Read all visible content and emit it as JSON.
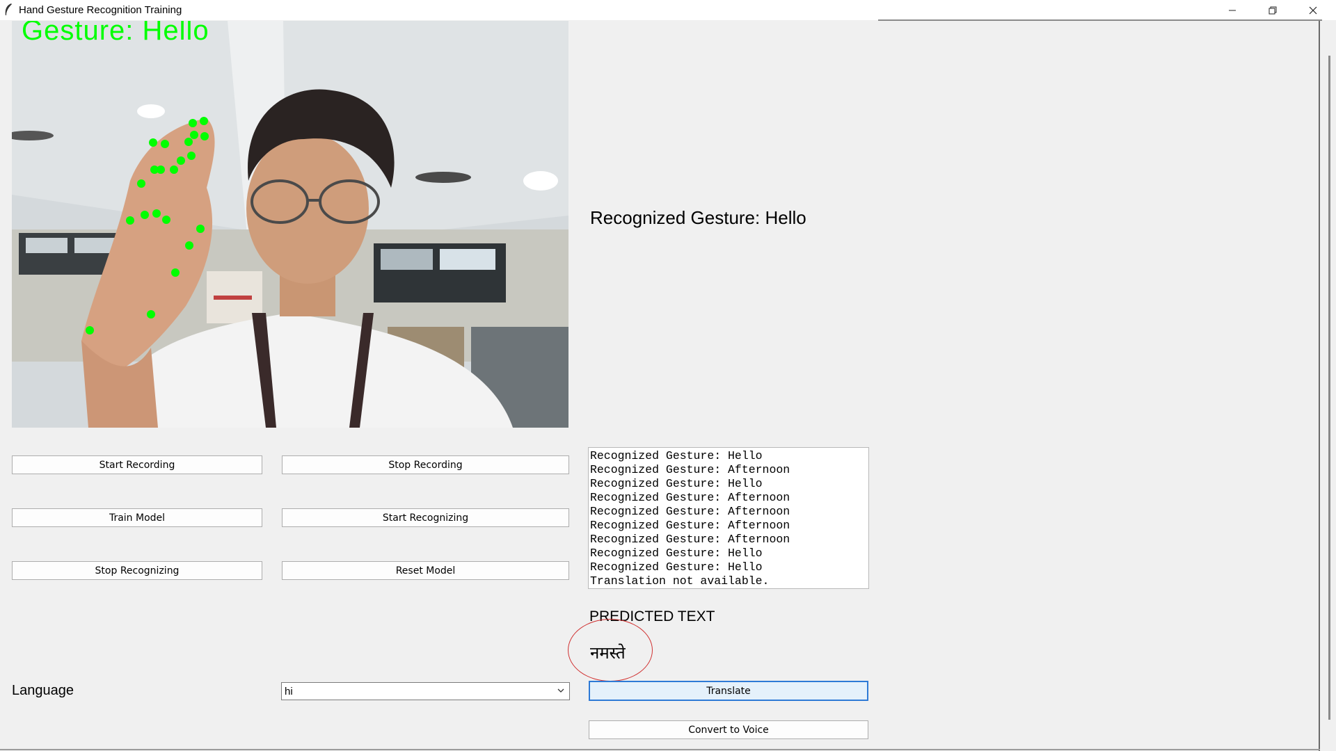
{
  "window": {
    "title": "Hand Gesture Recognition Training",
    "controls": {
      "minimize": "—",
      "maximize": "❐",
      "close": "✕"
    }
  },
  "video": {
    "overlay_text": "Gesture: Hello"
  },
  "recognized_label": "Recognized Gesture: Hello",
  "buttons": {
    "start_recording": "Start Recording",
    "stop_recording": "Stop Recording",
    "train_model": "Train Model",
    "start_recognizing": "Start Recognizing",
    "stop_recognizing": "Stop Recognizing",
    "reset_model": "Reset Model",
    "translate": "Translate",
    "convert_to_voice": "Convert to Voice"
  },
  "log": [
    "Recognized Gesture: Hello",
    "Recognized Gesture: Afternoon",
    "Recognized Gesture: Hello",
    "Recognized Gesture: Afternoon",
    "Recognized Gesture: Afternoon",
    "Recognized Gesture: Afternoon",
    "Recognized Gesture: Afternoon",
    "Recognized Gesture: Hello",
    "Recognized Gesture: Hello",
    "Translation not available."
  ],
  "predicted": {
    "label": "PREDICTED TEXT",
    "value": "नमस्ते"
  },
  "language": {
    "label": "Language",
    "selected": "hi"
  },
  "colors": {
    "landmark": "#00ff00",
    "highlight_circle": "#d03030",
    "focus_border": "#2e7ad6"
  }
}
